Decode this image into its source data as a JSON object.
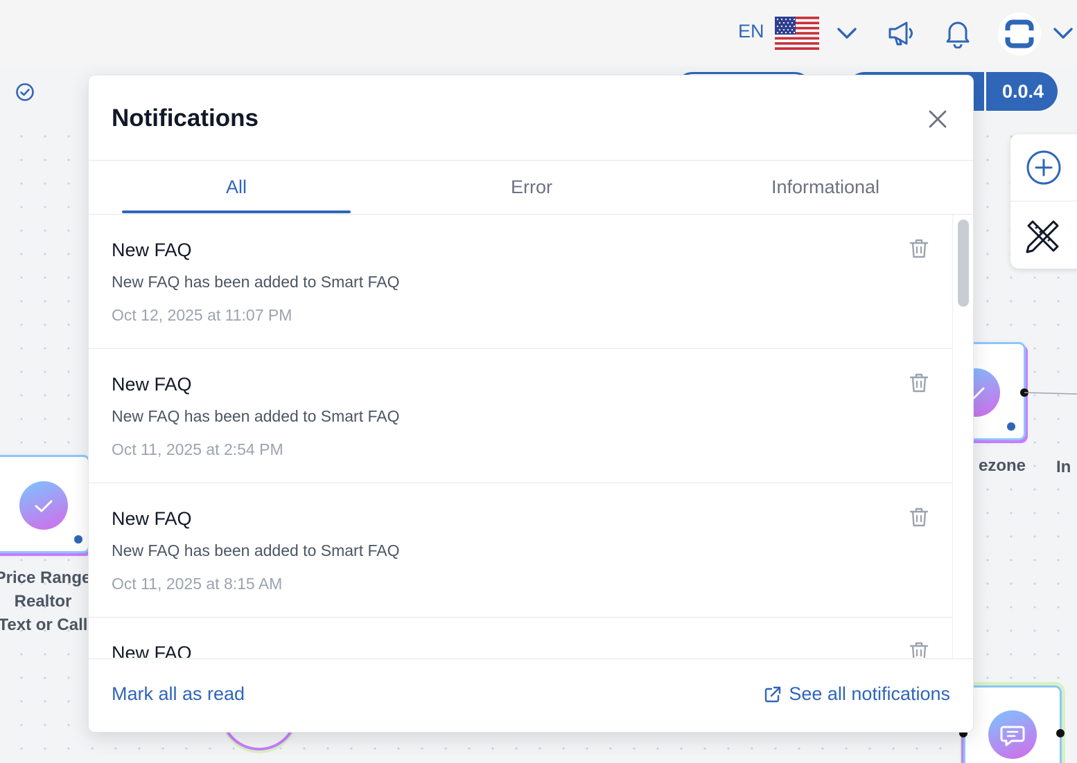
{
  "header": {
    "language_code": "EN",
    "language_flag": "us-flag-icon",
    "icons": [
      "chevron-down-icon",
      "megaphone-icon",
      "bell-icon",
      "user-avatar",
      "chevron-down-icon"
    ]
  },
  "toolbar": {
    "version": "0.0.4"
  },
  "canvas": {
    "nodes": [
      {
        "label_lines": [
          "Price Range",
          "Realtor",
          "Text or Call"
        ]
      },
      {
        "label_lines": [
          "ezone"
        ]
      },
      {
        "label_lines": [
          "In"
        ]
      }
    ]
  },
  "notifications": {
    "title": "Notifications",
    "tabs": [
      {
        "label": "All",
        "active": true
      },
      {
        "label": "Error",
        "active": false
      },
      {
        "label": "Informational",
        "active": false
      }
    ],
    "items": [
      {
        "title": "New FAQ",
        "message": "New FAQ has been added to Smart FAQ",
        "time": "Oct 12, 2025 at 11:07 PM"
      },
      {
        "title": "New FAQ",
        "message": "New FAQ has been added to Smart FAQ",
        "time": "Oct 11, 2025 at 2:54 PM"
      },
      {
        "title": "New FAQ",
        "message": "New FAQ has been added to Smart FAQ",
        "time": "Oct 11, 2025 at 8:15 AM"
      },
      {
        "title": "New FAQ",
        "message": "",
        "time": ""
      }
    ],
    "footer": {
      "mark_all_read": "Mark all as read",
      "see_all": "See all notifications"
    }
  },
  "colors": {
    "accent": "#2f66b8",
    "node_gradient_start": "#7cc4ff",
    "node_gradient_end": "#d36be8"
  }
}
